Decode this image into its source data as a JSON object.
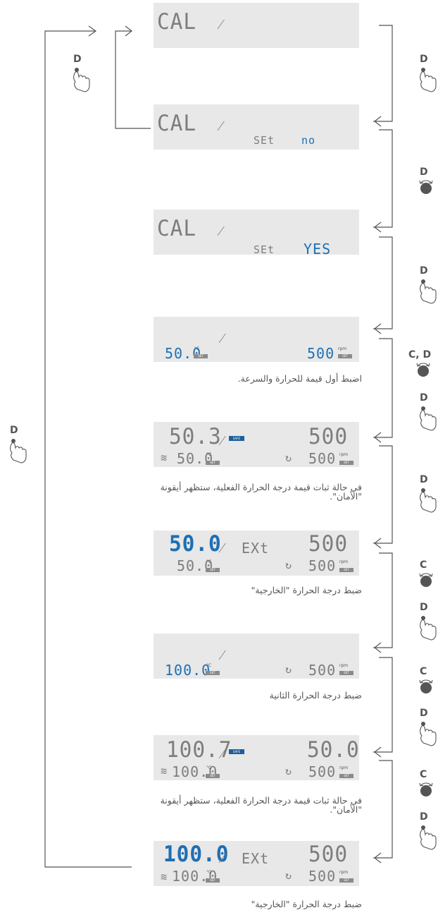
{
  "panels": [
    {
      "top_text": "CAL",
      "set_label": "",
      "set_value": ""
    },
    {
      "top_text": "CAL",
      "set_label": "SEt",
      "set_value": "no"
    },
    {
      "top_text": "CAL",
      "set_label": "SEt",
      "set_value": "YES"
    },
    {
      "left_set": "50.0",
      "right_set": "500",
      "unit_c": "°C",
      "unit_rpm": "rpm",
      "set_tag": "SET"
    },
    {
      "big_left": "50.3",
      "big_right": "500",
      "left_set": "50.0",
      "right_set": "500",
      "safe_tag": "SAFE"
    },
    {
      "big_left": "50.0",
      "mid_text": "EXt",
      "big_right": "500",
      "left_set": "50.0",
      "right_set": "500"
    },
    {
      "left_set": "100.0",
      "right_set": "500"
    },
    {
      "big_left": "100.7",
      "big_right": "50.0",
      "left_set": "100.0",
      "right_set": "500",
      "safe_tag": "SAFE"
    },
    {
      "big_left": "100.0",
      "mid_text": "EXt",
      "big_right": "500",
      "left_set": "100.0",
      "right_set": "500"
    }
  ],
  "captions": [
    "اضبط أول قيمة للحرارة والسرعة.",
    "في حالة ثبات قيمة درجة الحرارة الفعلية، ستظهر أيقونة \"الأمان\".",
    "ضبط درجة الحرارة \"الخارجية\"",
    "ضبط درجة الحرارة الثانية",
    "في حالة ثبات قيمة درجة الحرارة الفعلية، ستظهر أيقونة \"الأمان\".",
    "ضبط درجة الحرارة \"الخارجية\""
  ],
  "right_steps": [
    {
      "label": "D",
      "icon": "press-hand-icon"
    },
    {
      "label": "D",
      "icon": "rotate-knob-icon"
    },
    {
      "label": "D",
      "icon": "press-hand-icon"
    },
    {
      "label": "C, D",
      "icon": "rotate-knob-icon"
    },
    {
      "label": "D",
      "icon": "press-hand-icon"
    },
    {
      "label": "D",
      "icon": "press-hand-icon"
    },
    {
      "label": "C",
      "icon": "rotate-knob-icon"
    },
    {
      "label": "D",
      "icon": "press-hand-icon"
    },
    {
      "label": "C",
      "icon": "rotate-knob-icon"
    },
    {
      "label": "D",
      "icon": "press-hand-icon"
    },
    {
      "label": "C",
      "icon": "rotate-knob-icon"
    },
    {
      "label": "D",
      "icon": "press-hand-icon"
    }
  ],
  "left_steps": [
    {
      "label": "D",
      "icon": "press-hand-icon"
    },
    {
      "label": "D",
      "icon": "press-hand-icon"
    }
  ],
  "colors": {
    "lcd_bg": "#e8e8e8",
    "segment_grey": "#7d7d7d",
    "segment_blue": "#1f6fb3",
    "lines": "#555555"
  }
}
